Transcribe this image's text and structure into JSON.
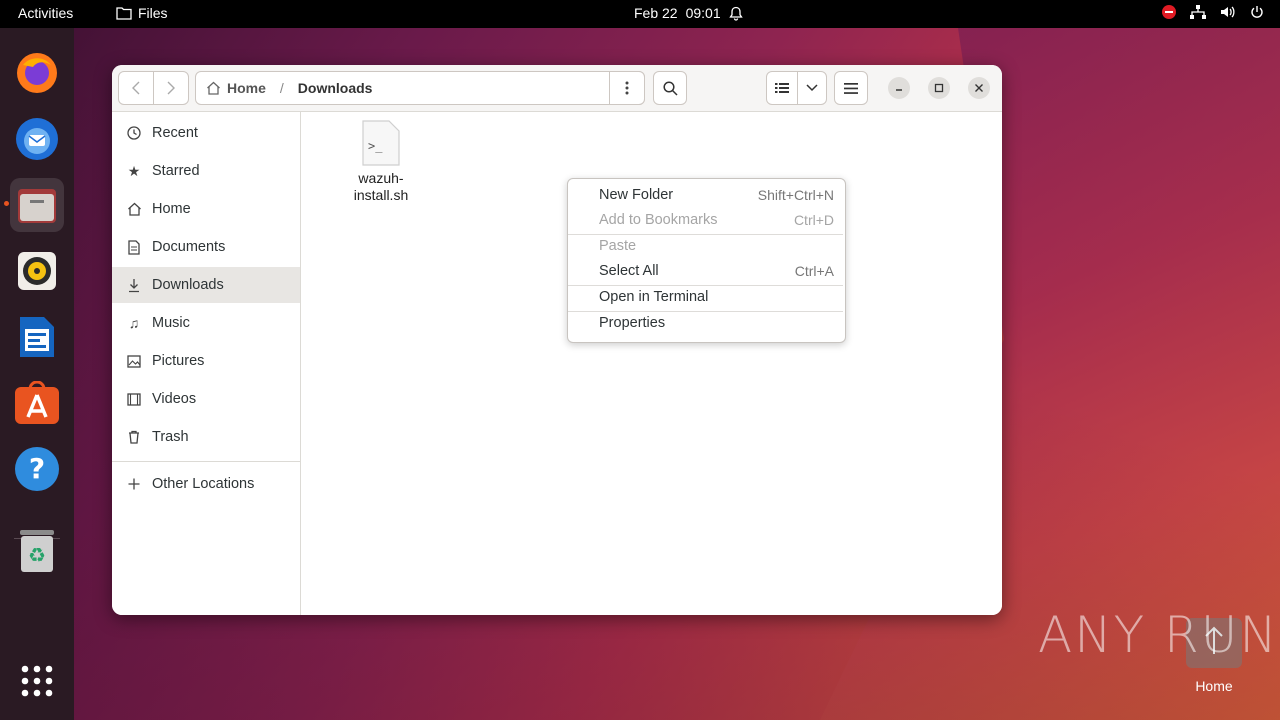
{
  "topbar": {
    "activities": "Activities",
    "app_name": "Files",
    "date": "Feb 22",
    "time": "09:01"
  },
  "dock": {
    "items": [
      "firefox-icon",
      "thunderbird-icon",
      "files-icon",
      "rhythmbox-icon",
      "libreoffice-writer-icon",
      "app-center-icon",
      "help-icon",
      "trash-icon"
    ],
    "show_apps": "grid-icon"
  },
  "window": {
    "breadcrumb": {
      "home": "Home",
      "current": "Downloads"
    },
    "sidebar": {
      "items": [
        {
          "label": "Recent",
          "icon": "clock-icon"
        },
        {
          "label": "Starred",
          "icon": "star-icon"
        },
        {
          "label": "Home",
          "icon": "home-icon"
        },
        {
          "label": "Documents",
          "icon": "document-icon"
        },
        {
          "label": "Downloads",
          "icon": "download-icon",
          "selected": true
        },
        {
          "label": "Music",
          "icon": "music-icon"
        },
        {
          "label": "Pictures",
          "icon": "picture-icon"
        },
        {
          "label": "Videos",
          "icon": "video-icon"
        },
        {
          "label": "Trash",
          "icon": "trash-icon"
        }
      ],
      "other_locations": "Other Locations"
    },
    "files": [
      {
        "name_line1": "wazuh-",
        "name_line2": "install.sh",
        "icon": "shell-script-icon"
      }
    ]
  },
  "context_menu": {
    "items": [
      {
        "label": "New Folder",
        "accel": "Shift+Ctrl+N",
        "enabled": true
      },
      {
        "label": "Add to Bookmarks",
        "accel": "Ctrl+D",
        "enabled": false
      },
      {
        "label": "Paste",
        "accel": "",
        "enabled": false
      },
      {
        "label": "Select All",
        "accel": "Ctrl+A",
        "enabled": true
      },
      {
        "label": "Open in Terminal",
        "accel": "",
        "enabled": true
      },
      {
        "label": "Properties",
        "accel": "",
        "enabled": true
      }
    ]
  },
  "desktop": {
    "watermark": "ANY RUN",
    "home_label": "Home"
  }
}
